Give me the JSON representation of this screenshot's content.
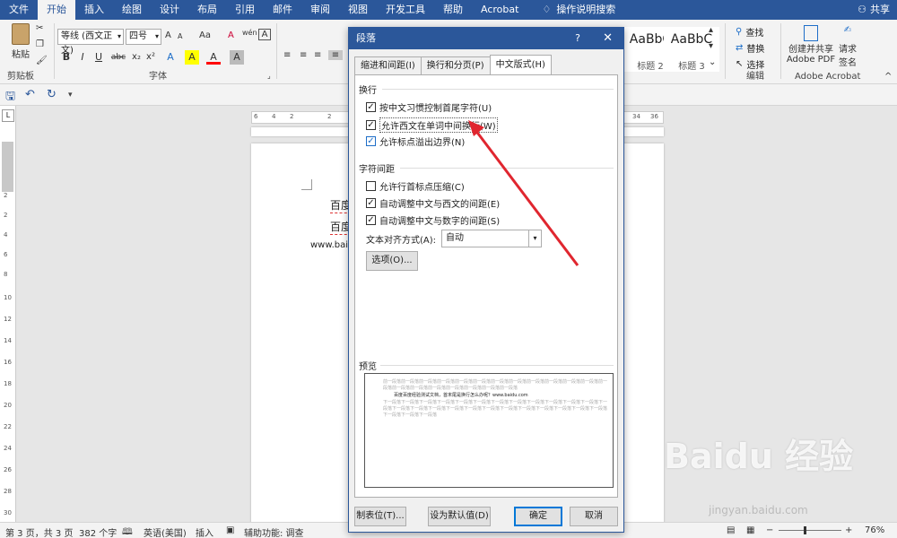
{
  "ribbon_tabs": [
    "文件",
    "开始",
    "插入",
    "绘图",
    "设计",
    "布局",
    "引用",
    "邮件",
    "审阅",
    "视图",
    "开发工具",
    "帮助",
    "Acrobat"
  ],
  "tell_me": "操作说明搜索",
  "share": "共享",
  "clipboard": {
    "paste": "粘贴",
    "label": "剪贴板"
  },
  "font_group": {
    "font_name": "等线 (西文正文)",
    "font_size": "四号",
    "label": "字体",
    "grow": "A",
    "shrink": "A",
    "case": "Aa",
    "clear": "A",
    "phonetic": "wén",
    "border": "A"
  },
  "font_buttons": [
    "B",
    "I",
    "U",
    "abc",
    "x₂",
    "x²",
    "A",
    "A",
    "A",
    "A"
  ],
  "styles": [
    {
      "preview": "AaBbC",
      "name": "标题 2"
    },
    {
      "preview": "AaBbC",
      "name": "标题 3"
    }
  ],
  "editing": {
    "find": "查找",
    "replace": "替换",
    "select": "选择",
    "label": "编辑"
  },
  "acrobat": {
    "create_share": "创建并共享",
    "create_share2": "Adobe PDF",
    "request": "请求",
    "request2": "签名",
    "label": "Adobe Acrobat"
  },
  "hruler_ticks": [
    "6",
    "4",
    "2",
    "2",
    "34",
    "36"
  ],
  "vruler_ticks": [
    "2",
    "2",
    "4",
    "6",
    "8",
    "10",
    "12",
    "14",
    "16",
    "18",
    "20",
    "22",
    "24",
    "26",
    "28",
    "30"
  ],
  "document": {
    "line1": "百度",
    "line2": "百度",
    "line3": "www.bai"
  },
  "dialog": {
    "title": "段落",
    "help": "?",
    "close": "✕",
    "tabs": [
      "缩进和间距(I)",
      "换行和分页(P)",
      "中文版式(H)"
    ],
    "section_line_break": "换行",
    "opt1": "按中文习惯控制首尾字符(U)",
    "opt2": "允许西文在单词中间换行(W)",
    "opt3": "允许标点溢出边界(N)",
    "section_char_spacing": "字符间距",
    "opt4": "允许行首标点压缩(C)",
    "opt5": "自动调整中文与西文的间距(E)",
    "opt6": "自动调整中文与数字的间距(S)",
    "text_align_label": "文本对齐方式(A):",
    "text_align_value": "自动",
    "options_button": "选项(O)...",
    "preview_label": "预览",
    "preview_prev": "前一段落前一段落前一段落前一段落前一段落前一段落前一段落前一段落前一段落前一段落前一段落前一段落前一段落前一段落前一段落前一段落前一段落前一段落前一段落前一段落",
    "preview_text": "百度百度经验测试文档，首末尾是换行怎么办呢？www.baidu.com",
    "preview_next": "下一段落下一段落下一段落下一段落下一段落下一段落下一段落下一段落下一段落下一段落下一段落下一段落下一段落下一段落下一段落下一段落下一段落下一段落下一段落下一段落下一段落下一段落下一段落下一段落下一段落下一段落下一段落下一段落",
    "tabs_button": "制表位(T)...",
    "default_button": "设为默认值(D)",
    "ok_button": "确定",
    "cancel_button": "取消"
  },
  "status": {
    "page": "第 3 页，共 3 页",
    "words": "382 个字",
    "language": "英语(美国)",
    "insert": "插入",
    "accessibility": "辅助功能: 调查",
    "zoom": "76%"
  },
  "watermark": {
    "logo": "Baidu 经验",
    "url": "jingyan.baidu.com"
  },
  "colors": {
    "ribbon_blue": "#2b579a",
    "arrow_red": "#e0262f",
    "font_color_red": "#ff0000"
  }
}
